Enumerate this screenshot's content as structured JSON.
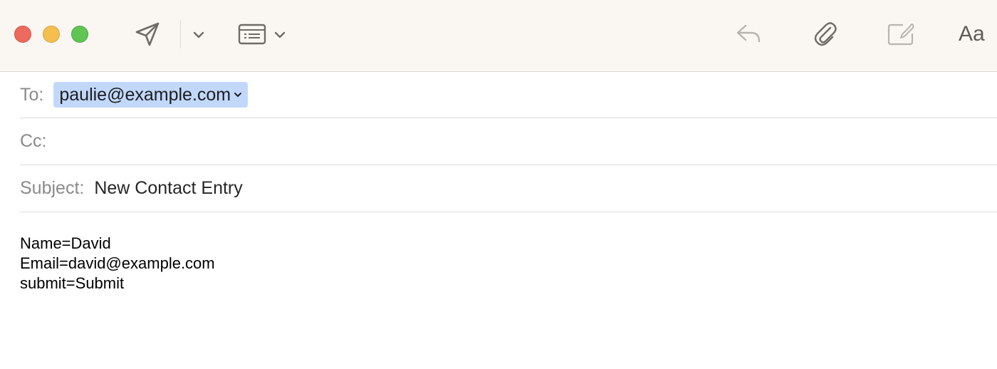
{
  "window": {
    "controls": [
      "close",
      "minimize",
      "zoom"
    ]
  },
  "toolbar": {
    "icons": {
      "send": "paper-plane-icon",
      "send_menu": "chevron-down-icon",
      "header_fields": "header-fields-icon",
      "header_menu": "chevron-down-icon",
      "reply": "reply-icon",
      "attach": "paperclip-icon",
      "markup": "markup-icon"
    },
    "font_label": "Aa"
  },
  "header": {
    "to_label": "To:",
    "to_recipients": [
      "paulie@example.com"
    ],
    "cc_label": "Cc:",
    "cc_value": "",
    "subject_label": "Subject:",
    "subject_value": "New Contact Entry"
  },
  "body": {
    "lines": [
      "Name=David",
      "Email=david@example.com",
      "submit=Submit"
    ]
  },
  "colors": {
    "toolbar_bg": "#faf7f2",
    "token_bg": "#c2d8fb",
    "close": "#ed6a5e",
    "minimize": "#f5bf4f",
    "zoom": "#61c554"
  }
}
